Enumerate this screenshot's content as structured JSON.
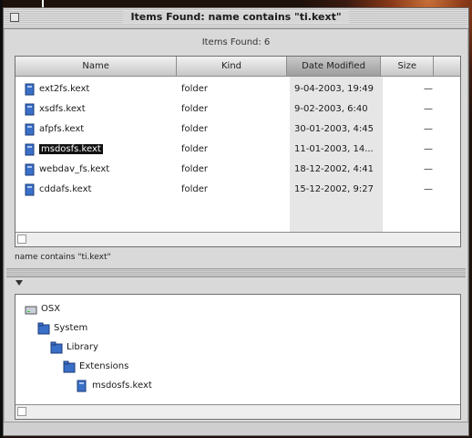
{
  "window": {
    "title": "Items Found: name contains \"ti.kext\"",
    "found_line": "Items Found: 6"
  },
  "columns": [
    "Name",
    "Kind",
    "Date Modified",
    "Size"
  ],
  "rows": [
    {
      "name": "ext2fs.kext",
      "kind": "folder",
      "date": "9-04-2003, 19:49",
      "size": "—"
    },
    {
      "name": "xsdfs.kext",
      "kind": "folder",
      "date": "9-02-2003, 6:40",
      "size": "—"
    },
    {
      "name": "afpfs.kext",
      "kind": "folder",
      "date": "30-01-2003, 4:45",
      "size": "—"
    },
    {
      "name": "msdosfs.kext",
      "kind": "folder",
      "date": "11-01-2003, 14...",
      "size": "—",
      "selected": true
    },
    {
      "name": "webdav_fs.kext",
      "kind": "folder",
      "date": "18-12-2002, 4:41",
      "size": "—"
    },
    {
      "name": "cddafs.kext",
      "kind": "folder",
      "date": "15-12-2002, 9:27",
      "size": "—"
    }
  ],
  "criteria": "name contains \"ti.kext\"",
  "tree": [
    {
      "label": "OSX",
      "indent": 0,
      "icon": "disk-icon"
    },
    {
      "label": "System",
      "indent": 1,
      "icon": "folder-icon"
    },
    {
      "label": "Library",
      "indent": 2,
      "icon": "folder-icon"
    },
    {
      "label": "Extensions",
      "indent": 3,
      "icon": "folder-icon"
    },
    {
      "label": "msdosfs.kext",
      "indent": 4,
      "icon": "file-icon"
    }
  ],
  "colors": {
    "icon_blue": "#3a6fc8",
    "selection": "#111111"
  }
}
